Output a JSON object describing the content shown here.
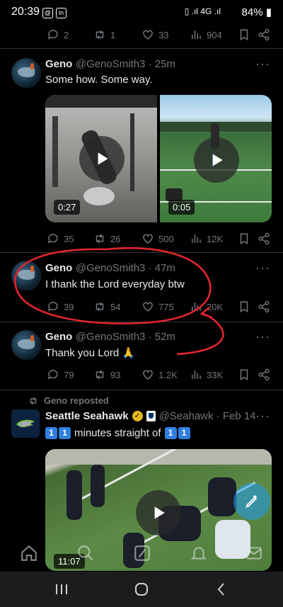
{
  "status": {
    "time": "20:39",
    "battery": "84%",
    "network": "4G"
  },
  "top_actions": {
    "replies": "2",
    "reposts": "1",
    "likes": "33",
    "views": "904"
  },
  "tweets": [
    {
      "name": "Geno",
      "handle": "@GenoSmith3 · 25m",
      "text": "Some how. Some way.",
      "videos": [
        {
          "duration": "0:27"
        },
        {
          "duration": "0:05"
        }
      ],
      "actions": {
        "replies": "35",
        "reposts": "26",
        "likes": "500",
        "views": "12K"
      }
    },
    {
      "name": "Geno",
      "handle": "@GenoSmith3 · 47m",
      "text": "I thank the Lord everyday btw",
      "actions": {
        "replies": "39",
        "reposts": "54",
        "likes": "775",
        "views": "20K"
      }
    },
    {
      "name": "Geno",
      "handle": "@GenoSmith3 · 52m",
      "text": "Thank you Lord 🙏",
      "actions": {
        "replies": "79",
        "reposts": "93",
        "likes": "1.2K",
        "views": "33K"
      }
    }
  ],
  "repost": {
    "label": "Geno reposted",
    "name": "Seattle Seahawk",
    "handle": "@Seahawk · Feb 14",
    "text_prefix": "1",
    "text_prefix2": "1",
    "text_mid": "minutes straight of",
    "text_suffix": "1",
    "text_suffix2": "1",
    "video_duration": "11:07"
  },
  "annotation": {
    "color": "#e0262e"
  },
  "colors": {
    "muted": "#71767b",
    "accent": "#1d9bf0",
    "annotation": "#e0262e"
  }
}
